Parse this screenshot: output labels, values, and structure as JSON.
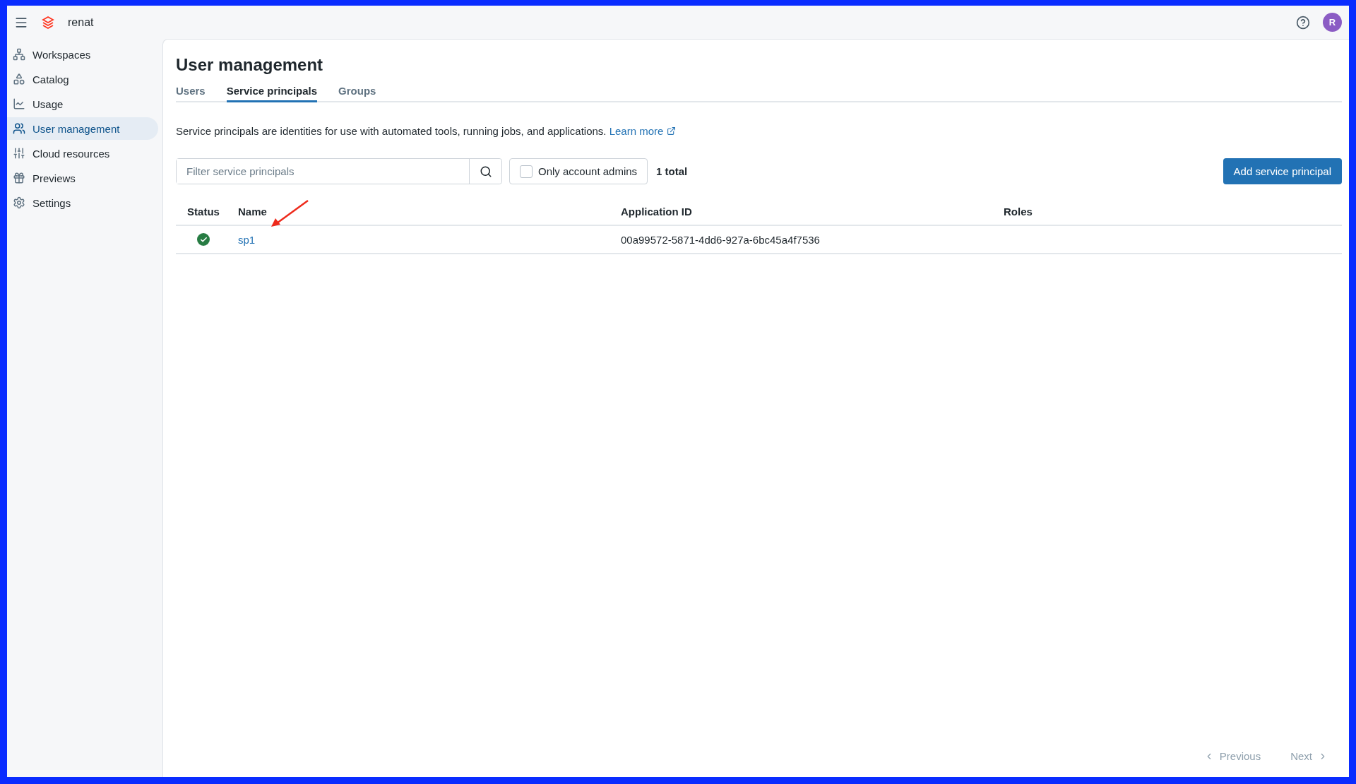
{
  "topbar": {
    "account": "renat",
    "avatar": "R"
  },
  "sidebar": {
    "items": [
      {
        "label": "Workspaces",
        "selected": false
      },
      {
        "label": "Catalog",
        "selected": false
      },
      {
        "label": "Usage",
        "selected": false
      },
      {
        "label": "User management",
        "selected": true
      },
      {
        "label": "Cloud resources",
        "selected": false
      },
      {
        "label": "Previews",
        "selected": false
      },
      {
        "label": "Settings",
        "selected": false
      }
    ]
  },
  "page": {
    "title": "User management",
    "tabs": [
      {
        "label": "Users",
        "selected": false
      },
      {
        "label": "Service principals",
        "selected": true
      },
      {
        "label": "Groups",
        "selected": false
      }
    ],
    "description": "Service principals are identities for use with automated tools, running jobs, and applications.",
    "learn_more": "Learn more",
    "filter": {
      "placeholder": "Filter service principals"
    },
    "admins_only": {
      "label": "Only account admins",
      "checked": false
    },
    "total": "1 total",
    "add_button": "Add service principal",
    "table": {
      "columns": [
        "Status",
        "Name",
        "Application ID",
        "Roles"
      ],
      "rows": [
        {
          "active": true,
          "name": "sp1",
          "application_id": "00a99572-5871-4dd6-927a-6bc45a4f7536"
        }
      ]
    },
    "pagination": {
      "previous": {
        "label": "Previous",
        "disabled": true
      },
      "next": {
        "label": "Next",
        "disabled": true
      }
    }
  }
}
